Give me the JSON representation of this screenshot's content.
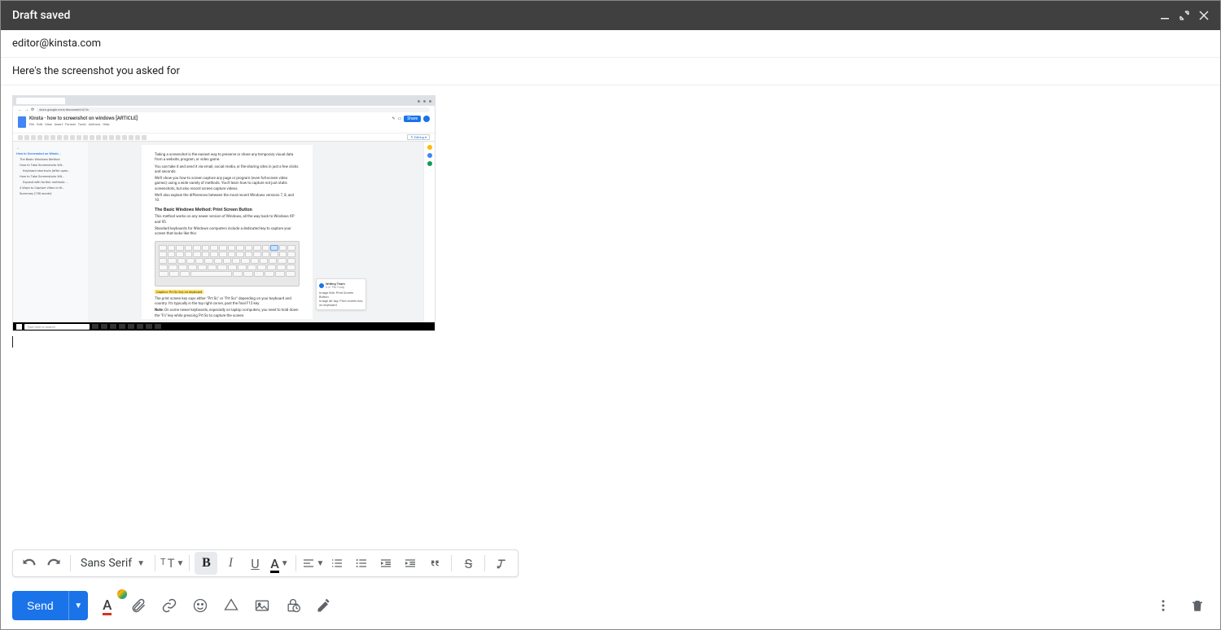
{
  "window": {
    "title": "Draft saved"
  },
  "email": {
    "to": "editor@kinsta.com",
    "subject": "Here's the screenshot you asked for"
  },
  "attachment": {
    "docs_title": "Kinsta - how to screenshot on windows [ARTICLE]",
    "docs_url": "docs.google.com/document/d/1b",
    "share_label": "Share",
    "menu": [
      "File",
      "Edit",
      "View",
      "Insert",
      "Format",
      "Tools",
      "Add-ons",
      "Help"
    ],
    "outline": {
      "heading": "How to Screenshot on Windo...",
      "items": [
        "The Basic Windows Method",
        "How to Take Screenshots Wit...",
        "Keyboard shortcuts (after open...",
        "How to Take Screenshots Wit...",
        "Expand with further methods ...",
        "4 Ways to Capture Video in W...",
        "Summary (150 words)"
      ]
    },
    "doc": {
      "p1": "Taking a screenshot is the easiest way to preserve or share any temporary visual data from a website, program, or video game.",
      "p2": "You can take it and send it via email, social media, or file-sharing sites in just a few clicks and seconds.",
      "p3": "We'll show you how to screen capture any page or program (even full-screen video games) using a wide variety of methods. You'll learn how to capture not just static screenshots, but also record screen capture videos.",
      "p4": "We'll also explain the differences between the most recent Windows versions 7, 8, and 10.",
      "h1": "The Basic Windows Method: Print Screen Button",
      "p5": "This method works on any newer version of Windows, all the way back to Windows XP and 95.",
      "p6": "Standard keyboards for Windows computers include a dedicated key to capture your screen that looks like this:",
      "caption": "Caption: Prt Sc key on keyboard",
      "p7": "The print screen key says either \"Prt Sc\" or \"Prt Scr\" depending on your keyboard and country. It's typically in the top right corner, past the final F12 key.",
      "p8_label": "Note:",
      "p8": " On some newer keyboards, especially on laptop computers, you need to hold down the \"Fn\" key while pressing Prt Sc to capture the screen."
    },
    "comment": {
      "author": "Writing Team",
      "time": "5:41 PM Today",
      "line1": "Image title: Print Screen Button",
      "line2": "Image alt tag: Print screen key on keyboard"
    },
    "taskbar_search": "Type here to search"
  },
  "format_toolbar": {
    "font": "Sans Serif"
  },
  "actions": {
    "send": "Send"
  }
}
